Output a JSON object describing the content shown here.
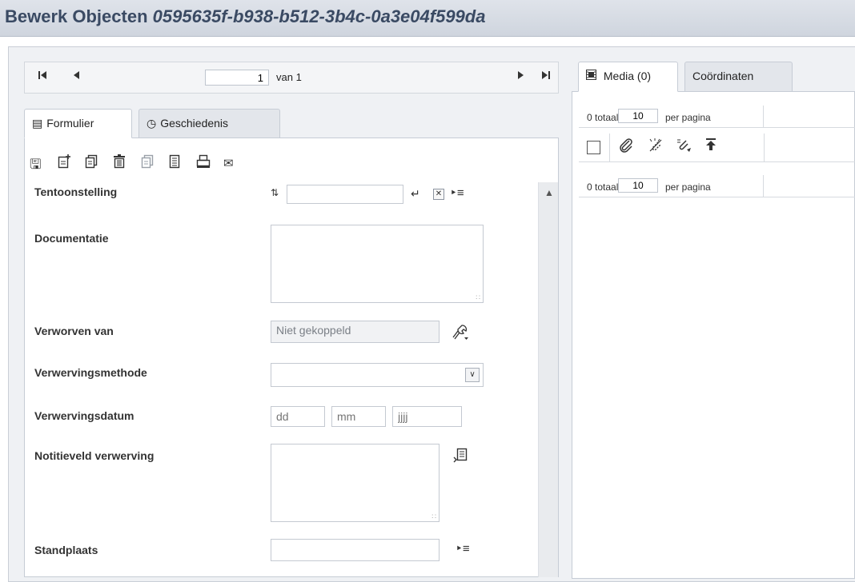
{
  "window": {
    "title_prefix": "Bewerk Objecten",
    "record_id": "0595635f-b938-b512-3b4c-0a3e04f599da"
  },
  "navigator": {
    "first_icon": "first-page-icon",
    "prev_icon": "previous-page-icon",
    "next_icon": "next-page-icon",
    "last_icon": "last-page-icon",
    "page_value": "1",
    "of_label": "van 1"
  },
  "left_tabs": [
    {
      "label": "Formulier",
      "icon": "form-icon",
      "active": true
    },
    {
      "label": "Geschiedenis",
      "icon": "history-icon",
      "active": false
    }
  ],
  "toolbar": [
    {
      "icon": "save-icon",
      "enabled": true
    },
    {
      "icon": "new-record-icon",
      "enabled": true
    },
    {
      "icon": "copy-record-icon",
      "enabled": true
    },
    {
      "icon": "delete-icon",
      "enabled": true
    },
    {
      "icon": "paste-icon",
      "enabled": false
    },
    {
      "icon": "notes-icon",
      "enabled": true
    },
    {
      "icon": "print-icon",
      "enabled": true
    },
    {
      "icon": "email-icon",
      "enabled": true
    }
  ],
  "form": {
    "exhibition_label": "Tentoonstelling",
    "exhibition_value": "",
    "documentation_label": "Documentatie",
    "documentation_value": "",
    "acquired_from_label": "Verworven van",
    "acquired_from_value": "Niet gekoppeld",
    "acquisition_method_label": "Verwervingsmethode",
    "acquisition_method_value": "",
    "acquisition_date_label": "Verwervingsdatum",
    "date_day_placeholder": "dd",
    "date_month_placeholder": "mm",
    "date_year_placeholder": "jjjj",
    "acquisition_note_label": "Notitieveld verwerving",
    "acquisition_note_value": "",
    "location_label": "Standplaats",
    "location_value": ""
  },
  "right_tabs": [
    {
      "label": "Media (0)",
      "icon": "film-icon",
      "active": true
    },
    {
      "label": "Coördinaten",
      "active": false
    }
  ],
  "media": {
    "total_text": "0 totaal",
    "per_page_value": "10",
    "per_page_label": "per pagina",
    "bottom_total_text": "0 totaal",
    "bottom_per_page_value": "10",
    "bottom_per_page_label": "per pagina"
  }
}
